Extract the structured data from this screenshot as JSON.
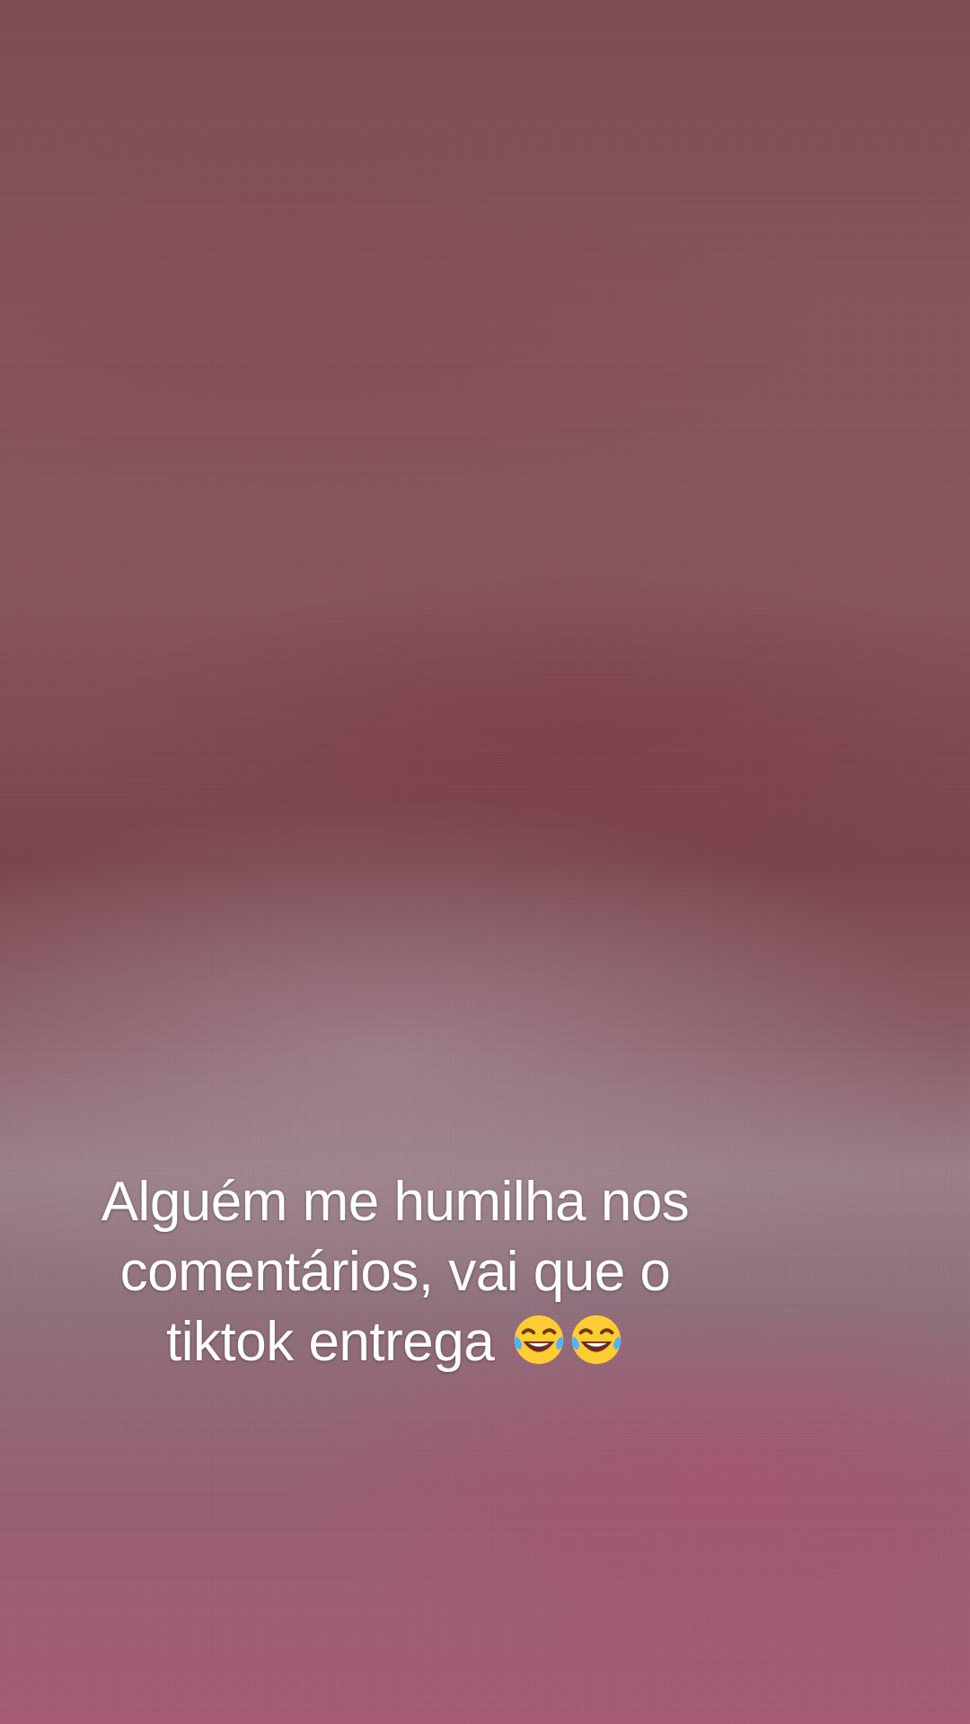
{
  "caption": {
    "line1": "Alguém me humilha nos",
    "line2": "comentários, vai que o",
    "line3": "tiktok entrega",
    "emoji": "face-with-tears-of-joy-icon",
    "emoji_count": 2
  },
  "colors": {
    "text": "#ffffff",
    "emoji_face": "#ffcc33",
    "emoji_tears": "#4fb3ff"
  }
}
